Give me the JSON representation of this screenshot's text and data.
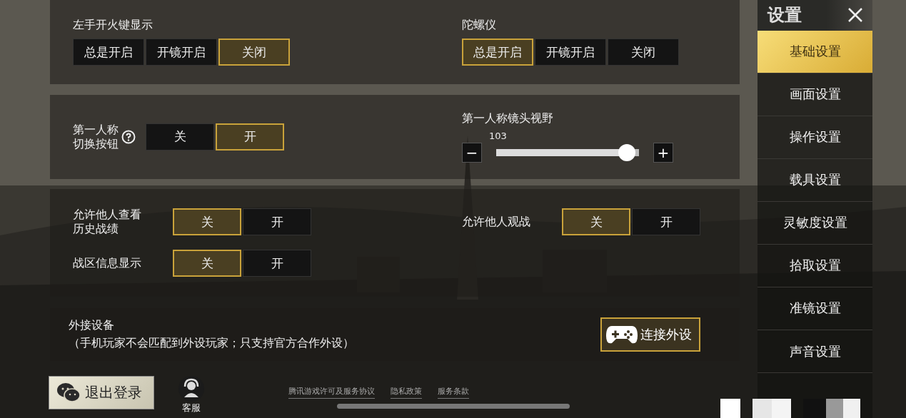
{
  "sections": [
    {
      "rows": [
        {
          "kind": "segmented",
          "label": "左手开火键显示",
          "options": [
            {
              "label": "总是开启",
              "selected": false
            },
            {
              "label": "开镜开启",
              "selected": false
            },
            {
              "label": "关闭",
              "selected": true
            }
          ]
        },
        {
          "kind": "segmented",
          "label": "陀螺仪",
          "options": [
            {
              "label": "总是开启",
              "selected": true
            },
            {
              "label": "开镜开启",
              "selected": false
            },
            {
              "label": "关闭",
              "selected": false
            }
          ]
        }
      ]
    },
    {
      "rows": [
        {
          "kind": "toggle",
          "label": [
            "第一人称",
            "切换按钮"
          ],
          "help": true,
          "options": [
            {
              "label": "关",
              "selected": false
            },
            {
              "label": "开",
              "selected": true
            }
          ]
        },
        {
          "kind": "slider",
          "label": "第一人称镜头视野",
          "value": "103",
          "level": 0.97,
          "minus": "−",
          "plus": "+"
        }
      ]
    },
    {
      "rows": [
        {
          "kind": "toggle",
          "label": [
            "允许他人查看",
            "历史战绩"
          ],
          "options": [
            {
              "label": "关",
              "selected": true
            },
            {
              "label": "开",
              "selected": false
            }
          ]
        },
        {
          "kind": "toggle",
          "label": [
            "允许他人观战"
          ],
          "options": [
            {
              "label": "关",
              "selected": true
            },
            {
              "label": "开",
              "selected": false
            }
          ]
        },
        {
          "kind": "toggle",
          "label": [
            "战区信息显示"
          ],
          "options": [
            {
              "label": "关",
              "selected": true
            },
            {
              "label": "开",
              "selected": false
            }
          ]
        }
      ]
    }
  ],
  "external": {
    "title": "外接设备",
    "note": "（手机玩家不会匹配到外设玩家；只支持官方合作外设）",
    "button": "连接外设"
  },
  "sidebar": {
    "title": "设置",
    "items": [
      {
        "label": "基础设置",
        "selected": true
      },
      {
        "label": "画面设置",
        "selected": false
      },
      {
        "label": "操作设置",
        "selected": false
      },
      {
        "label": "载具设置",
        "selected": false
      },
      {
        "label": "灵敏度设置",
        "selected": false
      },
      {
        "label": "拾取设置",
        "selected": false
      },
      {
        "label": "准镜设置",
        "selected": false
      },
      {
        "label": "声音设置",
        "selected": false
      }
    ]
  },
  "footer": {
    "logout": "退出登录",
    "service": "客服",
    "links": [
      "腾讯游戏许可及服务协议",
      "隐私政策",
      "服务条款"
    ]
  }
}
